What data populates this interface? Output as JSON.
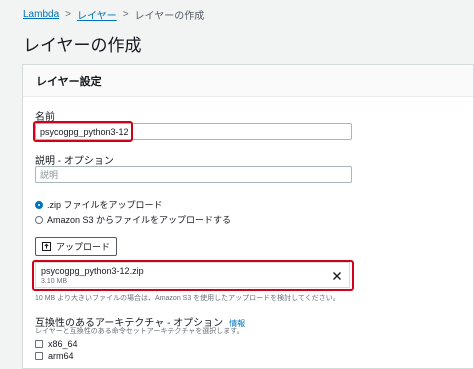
{
  "breadcrumb": {
    "items": [
      "Lambda",
      "レイヤー",
      "レイヤーの作成"
    ],
    "separator": ">"
  },
  "page": {
    "title": "レイヤーの作成"
  },
  "panel": {
    "header": "レイヤー設定",
    "name_label": "名前",
    "name_value": "psycogpg_python3-12",
    "description_label": "説明 - オプション",
    "description_placeholder": "説明",
    "radio_options": [
      {
        "label": ".zip ファイルをアップロード",
        "selected": true
      },
      {
        "label": "Amazon S3 からファイルをアップロードする",
        "selected": false
      }
    ],
    "upload_button": "アップロード",
    "file": {
      "name": "psycogpg_python3-12.zip",
      "size": "3.10 MB"
    },
    "size_hint": "10 MB より大きいファイルの場合は、Amazon S3 を使用したアップロードを検討してください。",
    "arch_label": "互換性のあるアーキテクチャ - オプション",
    "arch_info": "情報",
    "arch_hint": "レイヤーと互換性のある命令セットアーキテクチャを選択します。",
    "architectures": [
      {
        "label": "x86_64",
        "checked": false
      },
      {
        "label": "arm64",
        "checked": false
      }
    ]
  },
  "colors": {
    "link": "#0073bb",
    "highlight": "#d0021b",
    "background": "#f2f3f3"
  }
}
